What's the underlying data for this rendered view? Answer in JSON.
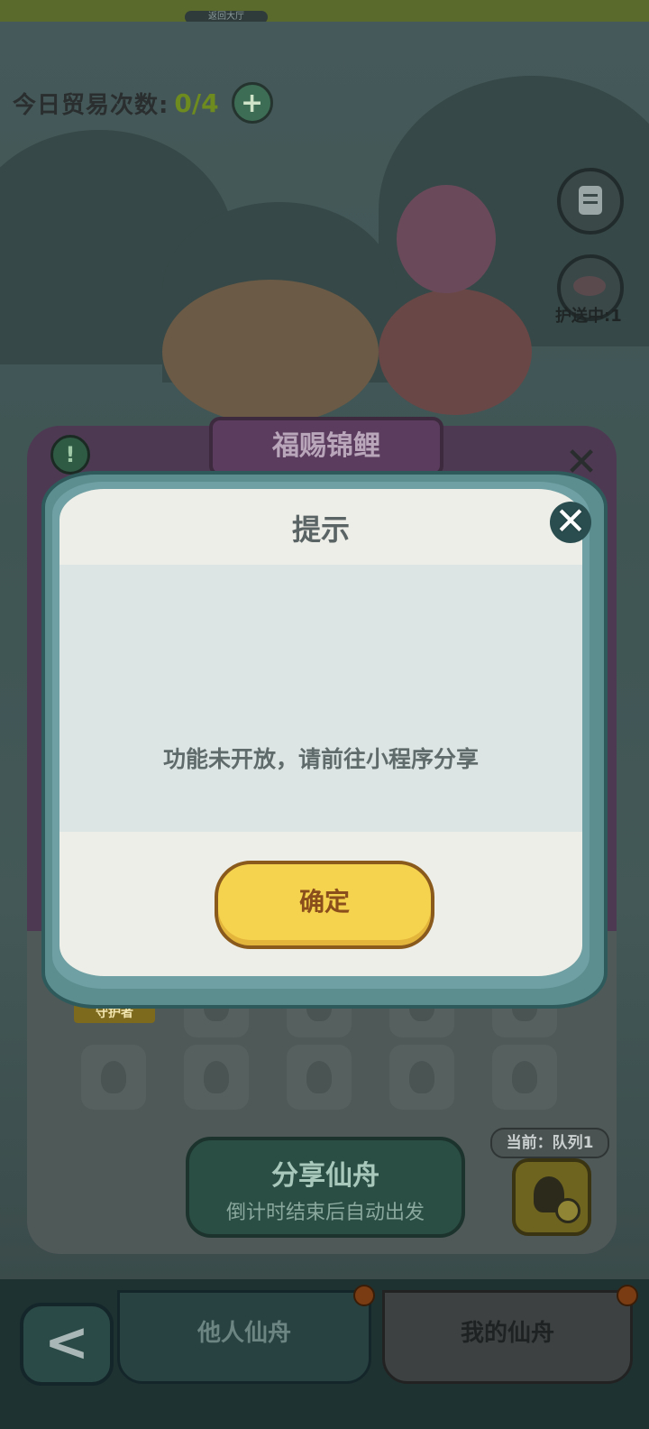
{
  "top_strip": {
    "pill_text": "返回大厅"
  },
  "trade": {
    "label": "今日贸易次数:",
    "count": "0/4",
    "add_glyph": "+"
  },
  "side": {
    "escort_label": "护送中:1"
  },
  "panel": {
    "title": "福赐锦鲤",
    "info_glyph": "!",
    "close_glyph": "✕",
    "guardian_label": "守护者",
    "share": {
      "title": "分享仙舟",
      "subtitle": "倒计时结束后自动出发"
    },
    "current_queue": "当前：队列1"
  },
  "dialog": {
    "title": "提示",
    "message": "功能未开放，请前往小程序分享",
    "confirm_label": "确定",
    "close_glyph": "✕"
  },
  "bottom_nav": {
    "back_glyph": "<",
    "tabs": [
      {
        "label": "他人仙舟",
        "active": false
      },
      {
        "label": "我的仙舟",
        "active": true
      }
    ]
  },
  "colors": {
    "overlay": "#3c4a4a",
    "dialog_frame": "#5c8e90",
    "confirm": "#f6d34e",
    "panel": "#4d3a52"
  },
  "icons": [
    "plus-icon",
    "document-icon",
    "fish-icon",
    "info-icon",
    "close-icon",
    "people-settings-icon",
    "back-arrow-icon"
  ]
}
